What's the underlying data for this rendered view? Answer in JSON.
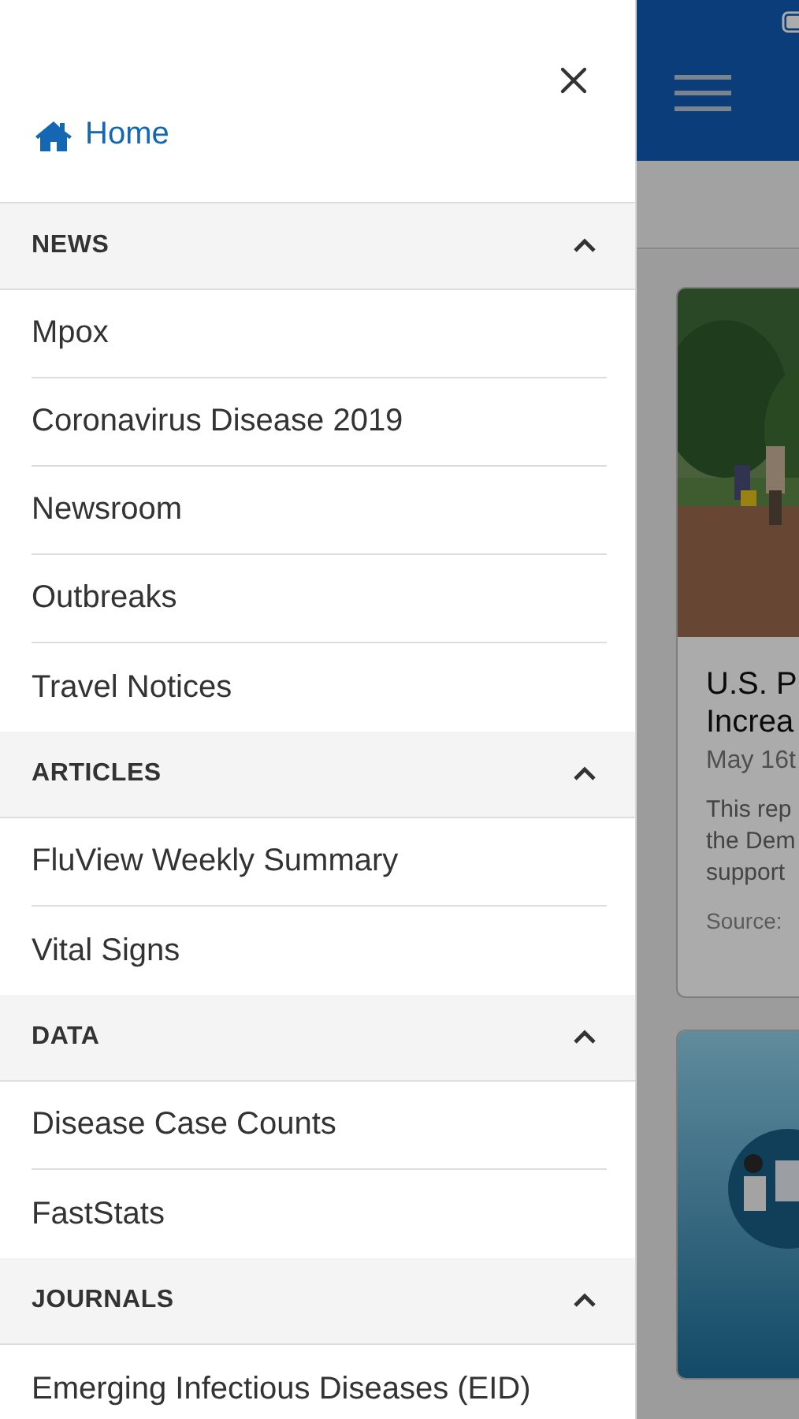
{
  "drawer": {
    "home": "Home",
    "sections": [
      {
        "title": "NEWS",
        "expanded": true,
        "items": [
          "Mpox",
          "Coronavirus Disease 2019",
          "Newsroom",
          "Outbreaks",
          "Travel Notices"
        ]
      },
      {
        "title": "ARTICLES",
        "expanded": true,
        "items": [
          "FluView Weekly Summary",
          "Vital Signs"
        ]
      },
      {
        "title": "DATA",
        "expanded": true,
        "items": [
          "Disease Case Counts",
          "FastStats"
        ]
      },
      {
        "title": "JOURNALS",
        "expanded": true,
        "items": [
          "Emerging Infectious Diseases (EID)"
        ]
      }
    ]
  },
  "feed": {
    "cards": [
      {
        "kind": "article",
        "title_lines": [
          "U.S. P",
          "Increa"
        ],
        "date": "May 16t",
        "summary_lines": [
          "This rep",
          "the Dem",
          "support"
        ],
        "source": "Source:"
      },
      {
        "kind": "picture"
      }
    ]
  }
}
